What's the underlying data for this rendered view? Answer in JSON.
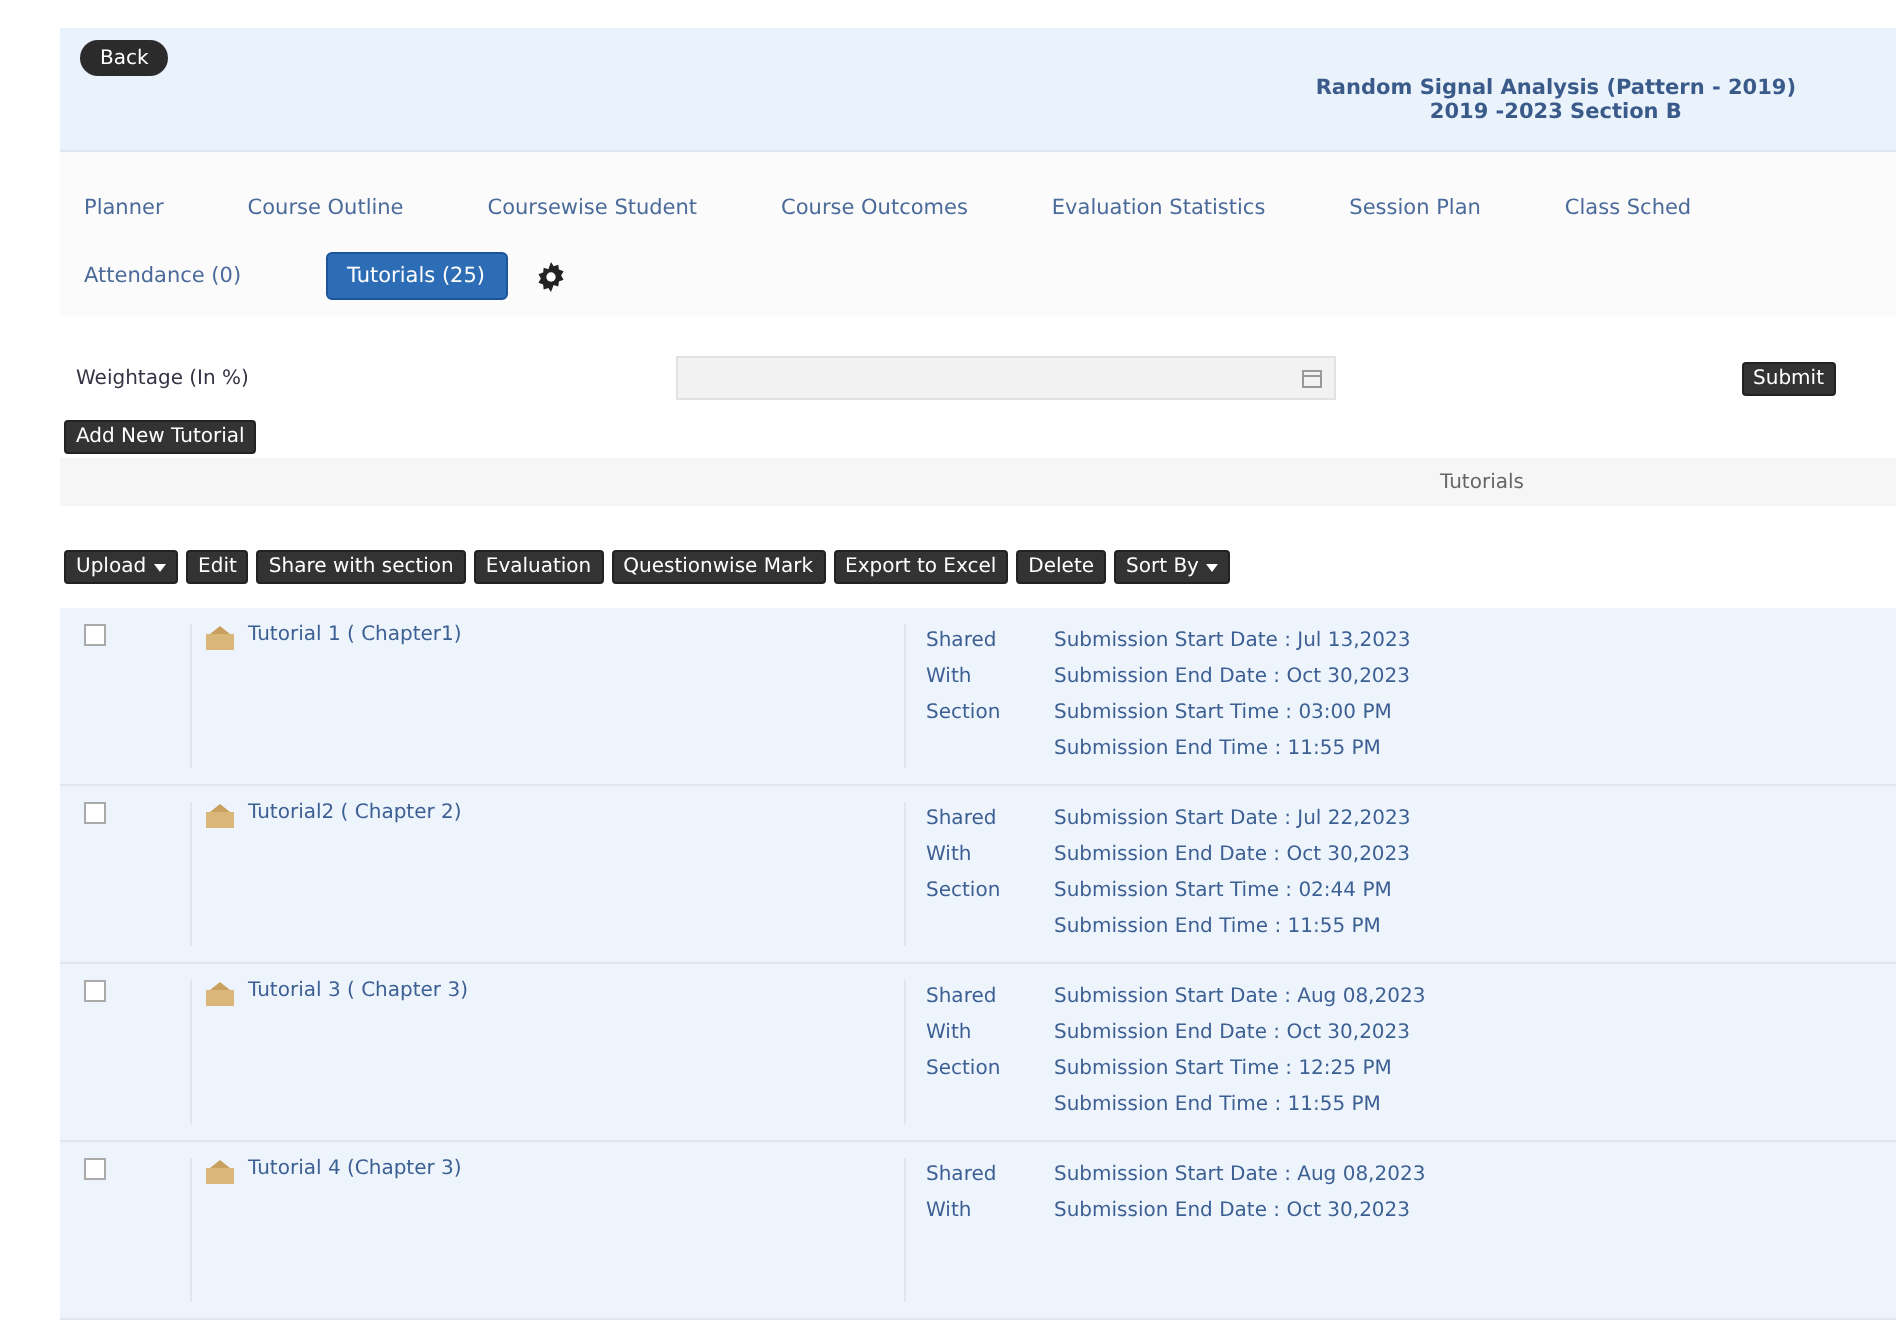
{
  "header": {
    "back_button": "Back",
    "course_title": "Random Signal Analysis (Pattern - 2019)",
    "course_section": "2019 -2023 Section B"
  },
  "tabs": [
    {
      "label": "Planner",
      "selected": false
    },
    {
      "label": "Course Outline",
      "selected": false
    },
    {
      "label": "Coursewise Student",
      "selected": false
    },
    {
      "label": "Course Outcomes",
      "selected": false
    },
    {
      "label": "Evaluation Statistics",
      "selected": false
    },
    {
      "label": "Session Plan",
      "selected": false
    },
    {
      "label": "Class Sched",
      "selected": false
    },
    {
      "label": "Attendance (0)",
      "selected": false
    },
    {
      "label": "Tutorials (25)",
      "selected": true
    }
  ],
  "weightage": {
    "label": "Weightage (In %)",
    "submit": "Submit"
  },
  "add_button": "Add New Tutorial",
  "section_title": "Tutorials",
  "toolbar": [
    {
      "label": "Upload",
      "dropdown": true
    },
    {
      "label": "Edit",
      "dropdown": false
    },
    {
      "label": "Share with section",
      "dropdown": false
    },
    {
      "label": "Evaluation",
      "dropdown": false
    },
    {
      "label": "Questionwise Mark",
      "dropdown": false
    },
    {
      "label": "Export to Excel",
      "dropdown": false
    },
    {
      "label": "Delete",
      "dropdown": false
    },
    {
      "label": "Sort By",
      "dropdown": true
    }
  ],
  "rows": [
    {
      "checked": false,
      "name": "Tutorial 1 ( Chapter1)",
      "status": "Shared With Section",
      "details": [
        "Submission Start Date : Jul 13,2023",
        "Submission End Date : Oct 30,2023",
        "Submission Start Time : 03:00 PM",
        "Submission End Time : 11:55 PM"
      ]
    },
    {
      "checked": false,
      "name": "Tutorial2 ( Chapter 2)",
      "status": "Shared With Section",
      "details": [
        "Submission Start Date : Jul 22,2023",
        "Submission End Date : Oct 30,2023",
        "Submission Start Time : 02:44 PM",
        "Submission End Time : 11:55 PM"
      ]
    },
    {
      "checked": false,
      "name": "Tutorial 3 ( Chapter 3)",
      "status": "Shared With Section",
      "details": [
        "Submission Start Date : Aug 08,2023",
        "Submission End Date : Oct 30,2023",
        "Submission Start Time : 12:25 PM",
        "Submission End Time : 11:55 PM"
      ]
    },
    {
      "checked": false,
      "name": "Tutorial 4 (Chapter 3)",
      "status": "Shared With",
      "details": [
        "Submission Start Date : Aug 08,2023",
        "Submission End Date : Oct 30,2023"
      ]
    }
  ]
}
